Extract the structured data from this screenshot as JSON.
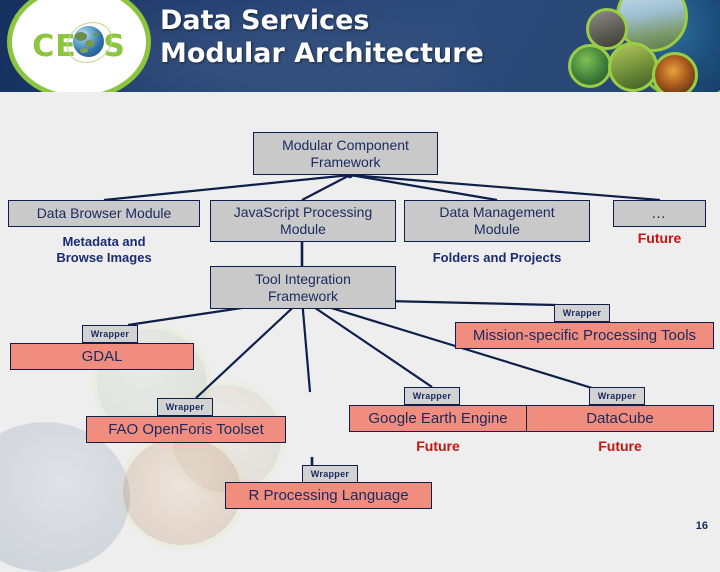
{
  "header": {
    "logo_text": "CEOS",
    "title_line1": "Data Services",
    "title_line2": "Modular Architecture"
  },
  "diagram": {
    "root": {
      "label": "Modular Component\nFramework"
    },
    "modules": [
      {
        "label": "Data Browser Module",
        "sublabel": "Metadata and\nBrowse Images"
      },
      {
        "label": "JavaScript Processing\nModule",
        "sublabel": ""
      },
      {
        "label": "Data Management\nModule",
        "sublabel": "Folders and Projects"
      },
      {
        "label": "…",
        "sublabel": "",
        "future": "Future"
      }
    ],
    "framework": {
      "label": "Tool Integration\nFramework"
    },
    "wrapper_label": "Wrapper",
    "tools": [
      {
        "label": "GDAL",
        "future": ""
      },
      {
        "label": "Mission-specific Processing Tools",
        "future": ""
      },
      {
        "label": "FAO OpenForis Toolset",
        "future": ""
      },
      {
        "label": "Google Earth Engine",
        "future": "Future"
      },
      {
        "label": "DataCube",
        "future": "Future"
      },
      {
        "label": "R Processing Language",
        "future": ""
      }
    ]
  },
  "footer": {
    "slide_number": "16"
  },
  "colors": {
    "banner": "#1d3b6e",
    "logo_green": "#8cc63e",
    "box_gray": "#c9c9c9",
    "box_salmon": "#f08d7e",
    "wire": "#0d1f4a",
    "label_blue": "#1b2b72",
    "future_red": "#cc1111"
  }
}
